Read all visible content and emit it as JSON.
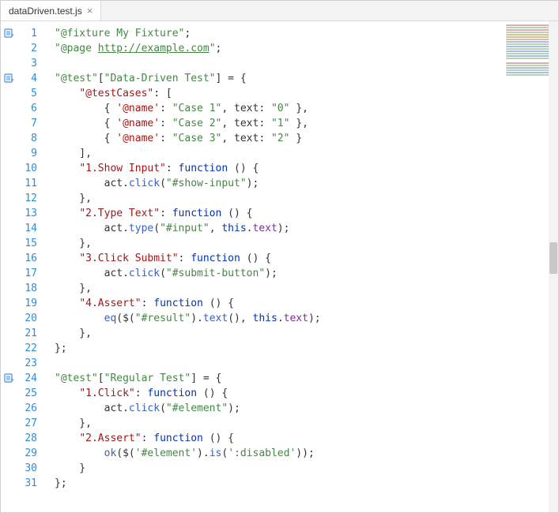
{
  "tab": {
    "title": "dataDriven.test.js",
    "close_glyph": "×"
  },
  "lines": [
    {
      "n": 1,
      "mark": true,
      "tokens": [
        {
          "c": "str",
          "t": "\"@fixture My Fixture\""
        },
        {
          "c": "punc",
          "t": ";"
        }
      ]
    },
    {
      "n": 2,
      "mark": false,
      "tokens": [
        {
          "c": "str",
          "t": "\"@page "
        },
        {
          "c": "link",
          "t": "http://example.com"
        },
        {
          "c": "str",
          "t": "\""
        },
        {
          "c": "punc",
          "t": ";"
        }
      ]
    },
    {
      "n": 3,
      "mark": false,
      "tokens": []
    },
    {
      "n": 4,
      "mark": true,
      "tokens": [
        {
          "c": "str",
          "t": "\"@test\""
        },
        {
          "c": "punc",
          "t": "["
        },
        {
          "c": "str",
          "t": "\"Data-Driven Test\""
        },
        {
          "c": "punc",
          "t": "] = {"
        }
      ]
    },
    {
      "n": 5,
      "mark": false,
      "tokens": [
        {
          "c": "punc",
          "t": "    "
        },
        {
          "c": "key",
          "t": "\"@testCases\""
        },
        {
          "c": "punc",
          "t": ": ["
        }
      ]
    },
    {
      "n": 6,
      "mark": false,
      "tokens": [
        {
          "c": "punc",
          "t": "        { "
        },
        {
          "c": "key",
          "t": "'@name'"
        },
        {
          "c": "punc",
          "t": ": "
        },
        {
          "c": "str",
          "t": "\"Case 1\""
        },
        {
          "c": "punc",
          "t": ", text: "
        },
        {
          "c": "str",
          "t": "\"0\""
        },
        {
          "c": "punc",
          "t": " },"
        }
      ]
    },
    {
      "n": 7,
      "mark": false,
      "tokens": [
        {
          "c": "punc",
          "t": "        { "
        },
        {
          "c": "key",
          "t": "'@name'"
        },
        {
          "c": "punc",
          "t": ": "
        },
        {
          "c": "str",
          "t": "\"Case 2\""
        },
        {
          "c": "punc",
          "t": ", text: "
        },
        {
          "c": "str",
          "t": "\"1\""
        },
        {
          "c": "punc",
          "t": " },"
        }
      ]
    },
    {
      "n": 8,
      "mark": false,
      "tokens": [
        {
          "c": "punc",
          "t": "        { "
        },
        {
          "c": "key",
          "t": "'@name'"
        },
        {
          "c": "punc",
          "t": ": "
        },
        {
          "c": "str",
          "t": "\"Case 3\""
        },
        {
          "c": "punc",
          "t": ", text: "
        },
        {
          "c": "str",
          "t": "\"2\""
        },
        {
          "c": "punc",
          "t": " }"
        }
      ]
    },
    {
      "n": 9,
      "mark": false,
      "tokens": [
        {
          "c": "punc",
          "t": "    ],"
        }
      ]
    },
    {
      "n": 10,
      "mark": false,
      "tokens": [
        {
          "c": "punc",
          "t": "    "
        },
        {
          "c": "key",
          "t": "\"1.Show Input\""
        },
        {
          "c": "punc",
          "t": ": "
        },
        {
          "c": "kw",
          "t": "function"
        },
        {
          "c": "punc",
          "t": " () {"
        }
      ]
    },
    {
      "n": 11,
      "mark": false,
      "tokens": [
        {
          "c": "punc",
          "t": "        act."
        },
        {
          "c": "fn",
          "t": "click"
        },
        {
          "c": "punc",
          "t": "("
        },
        {
          "c": "str",
          "t": "\"#show-input\""
        },
        {
          "c": "punc",
          "t": ");"
        }
      ]
    },
    {
      "n": 12,
      "mark": false,
      "tokens": [
        {
          "c": "punc",
          "t": "    },"
        }
      ]
    },
    {
      "n": 13,
      "mark": false,
      "tokens": [
        {
          "c": "punc",
          "t": "    "
        },
        {
          "c": "key",
          "t": "\"2.Type Text\""
        },
        {
          "c": "punc",
          "t": ": "
        },
        {
          "c": "kw",
          "t": "function"
        },
        {
          "c": "punc",
          "t": " () {"
        }
      ]
    },
    {
      "n": 14,
      "mark": false,
      "tokens": [
        {
          "c": "punc",
          "t": "        act."
        },
        {
          "c": "fn",
          "t": "type"
        },
        {
          "c": "punc",
          "t": "("
        },
        {
          "c": "str",
          "t": "\"#input\""
        },
        {
          "c": "punc",
          "t": ", "
        },
        {
          "c": "this",
          "t": "this"
        },
        {
          "c": "punc",
          "t": "."
        },
        {
          "c": "prop",
          "t": "text"
        },
        {
          "c": "punc",
          "t": ");"
        }
      ]
    },
    {
      "n": 15,
      "mark": false,
      "tokens": [
        {
          "c": "punc",
          "t": "    },"
        }
      ]
    },
    {
      "n": 16,
      "mark": false,
      "tokens": [
        {
          "c": "punc",
          "t": "    "
        },
        {
          "c": "key",
          "t": "\"3.Click Submit\""
        },
        {
          "c": "punc",
          "t": ": "
        },
        {
          "c": "kw",
          "t": "function"
        },
        {
          "c": "punc",
          "t": " () {"
        }
      ]
    },
    {
      "n": 17,
      "mark": false,
      "tokens": [
        {
          "c": "punc",
          "t": "        act."
        },
        {
          "c": "fn",
          "t": "click"
        },
        {
          "c": "punc",
          "t": "("
        },
        {
          "c": "str",
          "t": "\"#submit-button\""
        },
        {
          "c": "punc",
          "t": ");"
        }
      ]
    },
    {
      "n": 18,
      "mark": false,
      "tokens": [
        {
          "c": "punc",
          "t": "    },"
        }
      ]
    },
    {
      "n": 19,
      "mark": false,
      "tokens": [
        {
          "c": "punc",
          "t": "    "
        },
        {
          "c": "key",
          "t": "\"4.Assert\""
        },
        {
          "c": "punc",
          "t": ": "
        },
        {
          "c": "kw",
          "t": "function"
        },
        {
          "c": "punc",
          "t": " () {"
        }
      ]
    },
    {
      "n": 20,
      "mark": false,
      "tokens": [
        {
          "c": "punc",
          "t": "        "
        },
        {
          "c": "fn",
          "t": "eq"
        },
        {
          "c": "punc",
          "t": "($("
        },
        {
          "c": "str",
          "t": "\"#result\""
        },
        {
          "c": "punc",
          "t": ")."
        },
        {
          "c": "fn",
          "t": "text"
        },
        {
          "c": "punc",
          "t": "(), "
        },
        {
          "c": "this",
          "t": "this"
        },
        {
          "c": "punc",
          "t": "."
        },
        {
          "c": "prop",
          "t": "text"
        },
        {
          "c": "punc",
          "t": ");"
        }
      ]
    },
    {
      "n": 21,
      "mark": false,
      "tokens": [
        {
          "c": "punc",
          "t": "    },"
        }
      ]
    },
    {
      "n": 22,
      "mark": false,
      "tokens": [
        {
          "c": "punc",
          "t": "};"
        }
      ]
    },
    {
      "n": 23,
      "mark": false,
      "tokens": []
    },
    {
      "n": 24,
      "mark": true,
      "tokens": [
        {
          "c": "str",
          "t": "\"@test\""
        },
        {
          "c": "punc",
          "t": "["
        },
        {
          "c": "str",
          "t": "\"Regular Test\""
        },
        {
          "c": "punc",
          "t": "] = {"
        }
      ]
    },
    {
      "n": 25,
      "mark": false,
      "tokens": [
        {
          "c": "punc",
          "t": "    "
        },
        {
          "c": "key",
          "t": "\"1.Click\""
        },
        {
          "c": "punc",
          "t": ": "
        },
        {
          "c": "kw",
          "t": "function"
        },
        {
          "c": "punc",
          "t": " () {"
        }
      ]
    },
    {
      "n": 26,
      "mark": false,
      "tokens": [
        {
          "c": "punc",
          "t": "        act."
        },
        {
          "c": "fn",
          "t": "click"
        },
        {
          "c": "punc",
          "t": "("
        },
        {
          "c": "str",
          "t": "\"#element\""
        },
        {
          "c": "punc",
          "t": ");"
        }
      ]
    },
    {
      "n": 27,
      "mark": false,
      "tokens": [
        {
          "c": "punc",
          "t": "    },"
        }
      ]
    },
    {
      "n": 28,
      "mark": false,
      "tokens": [
        {
          "c": "punc",
          "t": "    "
        },
        {
          "c": "key",
          "t": "\"2.Assert\""
        },
        {
          "c": "punc",
          "t": ": "
        },
        {
          "c": "kw",
          "t": "function"
        },
        {
          "c": "punc",
          "t": " () {"
        }
      ]
    },
    {
      "n": 29,
      "mark": false,
      "tokens": [
        {
          "c": "punc",
          "t": "        "
        },
        {
          "c": "fn",
          "t": "ok"
        },
        {
          "c": "punc",
          "t": "($("
        },
        {
          "c": "str",
          "t": "'#element'"
        },
        {
          "c": "punc",
          "t": ")."
        },
        {
          "c": "fn",
          "t": "is"
        },
        {
          "c": "punc",
          "t": "("
        },
        {
          "c": "str",
          "t": "':disabled'"
        },
        {
          "c": "punc",
          "t": "));"
        }
      ]
    },
    {
      "n": 30,
      "mark": false,
      "tokens": [
        {
          "c": "punc",
          "t": "    }"
        }
      ]
    },
    {
      "n": 31,
      "mark": false,
      "tokens": [
        {
          "c": "punc",
          "t": "};"
        }
      ]
    }
  ],
  "minimap_rows": [
    "r",
    "g",
    "r",
    "g",
    "k",
    "k",
    "k",
    "b",
    "g",
    "b",
    "g",
    "b",
    "g",
    "b",
    "g",
    "",
    "r",
    "g",
    "b",
    "g",
    "b",
    "g"
  ]
}
